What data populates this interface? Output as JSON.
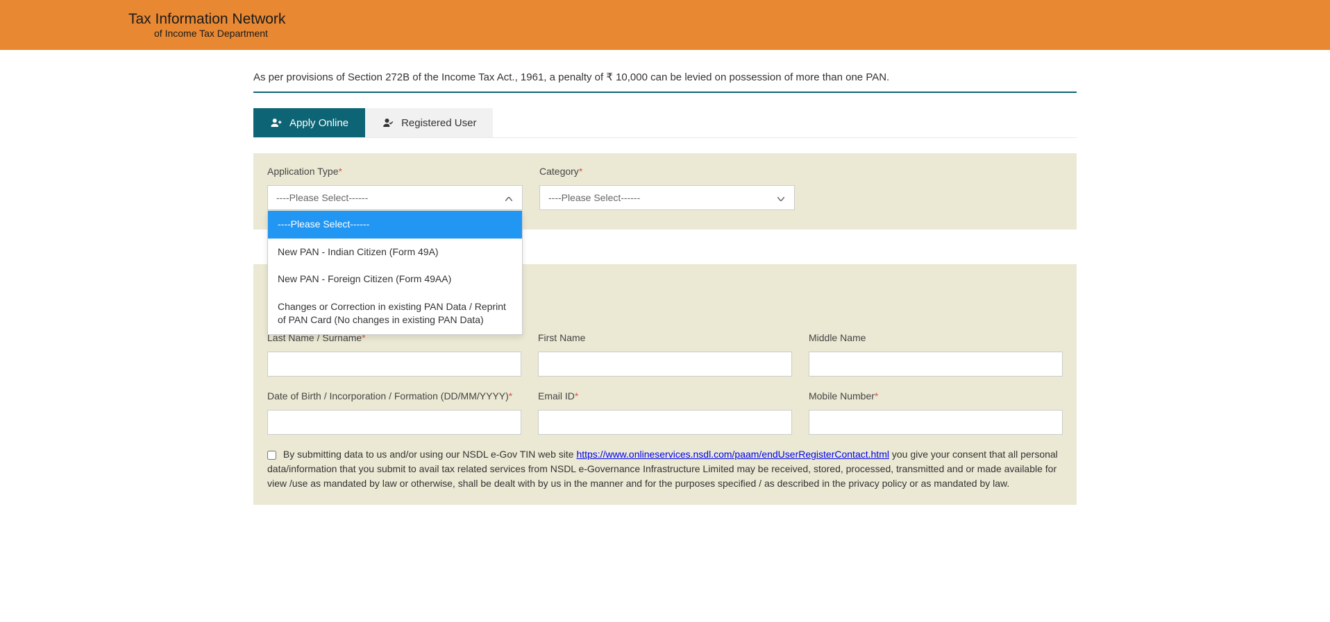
{
  "header": {
    "title": "Tax Information Network",
    "subtitle": "of Income Tax Department"
  },
  "notice": "As per provisions of Section 272B of the Income Tax Act., 1961, a penalty of ₹ 10,000 can be levied on possession of more than one PAN.",
  "tabs": {
    "apply_online": "Apply Online",
    "registered_user": "Registered User"
  },
  "form": {
    "application_type_label": "Application Type",
    "category_label": "Category",
    "please_select": "----Please Select------",
    "application_type_options": {
      "opt0": "----Please Select------",
      "opt1": "New PAN - Indian Citizen (Form 49A)",
      "opt2": "New PAN - Foreign Citizen (Form 49AA)",
      "opt3": "Changes or Correction in existing PAN Data / Reprint of PAN Card (No changes in existing PAN Data)"
    },
    "last_name_label": "Last Name / Surname",
    "first_name_label": "First Name",
    "middle_name_label": "Middle Name",
    "dob_label": "Date of Birth / Incorporation / Formation (DD/MM/YYYY)",
    "email_label": "Email ID",
    "mobile_label": "Mobile Number"
  },
  "consent": {
    "prefix": "By submitting data to us and/or using our NSDL e-Gov TIN web site ",
    "link_text": "https://www.onlineservices.nsdl.com/paam/endUserRegisterContact.html",
    "suffix": " you give your consent that all personal data/information that you submit to avail tax related services from NSDL e-Governance Infrastructure Limited may be received, stored, processed, transmitted and or made available for view /use as mandated by law or otherwise, shall be dealt with by us in the manner and for the purposes specified / as described in the privacy policy or as mandated by law."
  }
}
